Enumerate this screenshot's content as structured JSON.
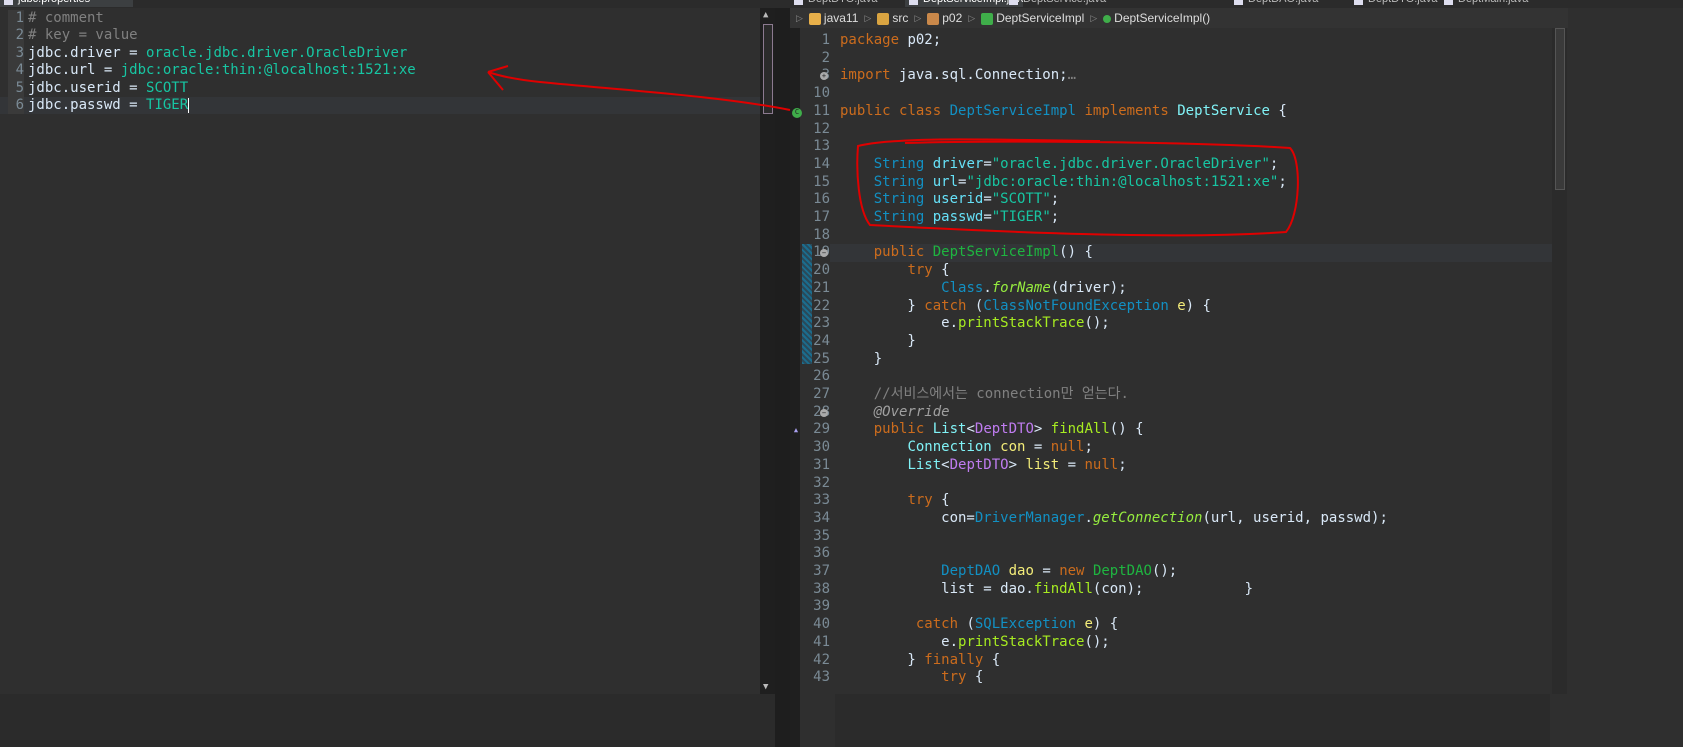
{
  "tabs": [
    {
      "label": "jdbc.properties",
      "active": true
    },
    {
      "label": "DeptDTO.java",
      "active": false
    },
    {
      "label": "DeptServiceImpl.java",
      "active": true
    },
    {
      "label": "DeptService.java",
      "active": false
    },
    {
      "label": "DeptDAO.java",
      "active": false
    },
    {
      "label": "DeptDTO.java",
      "active": false
    },
    {
      "label": "DeptMain.java",
      "active": false
    }
  ],
  "properties_editor": {
    "lines": [
      {
        "num": "1",
        "key": "# comment",
        "value": "",
        "comment": true
      },
      {
        "num": "2",
        "key": "# key = value",
        "value": "",
        "comment": true
      },
      {
        "num": "3",
        "key": "jdbc.driver = ",
        "value": "oracle.jdbc.driver.OracleDriver"
      },
      {
        "num": "4",
        "key": "jdbc.url = ",
        "value": "jdbc:oracle:thin:@localhost:1521:xe"
      },
      {
        "num": "5",
        "key": "jdbc.userid = ",
        "value": "SCOTT"
      },
      {
        "num": "6",
        "key": "jdbc.passwd = ",
        "value": "TIGER"
      }
    ]
  },
  "breadcrumb": [
    {
      "label": "java11",
      "icon": "project-icon",
      "color": "#e8b04a"
    },
    {
      "label": "src",
      "icon": "source-folder-icon",
      "color": "#d9a441"
    },
    {
      "label": "p02",
      "icon": "package-icon",
      "color": "#c9884a"
    },
    {
      "label": "DeptServiceImpl",
      "icon": "class-icon",
      "color": "#3fae4a"
    },
    {
      "label": "DeptServiceImpl()",
      "icon": "constructor-icon",
      "color": "#3fae4a"
    }
  ],
  "java_editor": {
    "lines": [
      {
        "num": "1",
        "tokens": [
          [
            "package",
            "k"
          ],
          [
            " p02;",
            "p"
          ]
        ]
      },
      {
        "num": "2",
        "tokens": []
      },
      {
        "num": "3",
        "marker": "fold-expand",
        "tokens": [
          [
            "import",
            "k"
          ],
          [
            " java.sql.Connection;",
            "p"
          ],
          [
            "…",
            "c"
          ]
        ]
      },
      {
        "num": "10",
        "tokens": []
      },
      {
        "num": "11",
        "marker": "class",
        "tokens": [
          [
            "public",
            "k"
          ],
          [
            " ",
            "p"
          ],
          [
            "class",
            "k"
          ],
          [
            " ",
            "p"
          ],
          [
            "DeptServiceImpl",
            "t"
          ],
          [
            " ",
            "p"
          ],
          [
            "implements",
            "k"
          ],
          [
            " ",
            "p"
          ],
          [
            "DeptService",
            "i"
          ],
          [
            " {",
            "p"
          ]
        ]
      },
      {
        "num": "12",
        "tokens": []
      },
      {
        "num": "13",
        "tokens": []
      },
      {
        "num": "14",
        "tokens": [
          [
            "    ",
            "p"
          ],
          [
            "String",
            "t"
          ],
          [
            " ",
            "p"
          ],
          [
            "driver",
            "f"
          ],
          [
            "=",
            "p"
          ],
          [
            "\"oracle.jdbc.driver.OracleDriver\"",
            "s"
          ],
          [
            ";",
            "p"
          ]
        ]
      },
      {
        "num": "15",
        "tokens": [
          [
            "    ",
            "p"
          ],
          [
            "String",
            "t"
          ],
          [
            " ",
            "p"
          ],
          [
            "url",
            "f"
          ],
          [
            "=",
            "p"
          ],
          [
            "\"jdbc:oracle:thin:@localhost:1521:xe\"",
            "s"
          ],
          [
            ";",
            "p"
          ]
        ]
      },
      {
        "num": "16",
        "tokens": [
          [
            "    ",
            "p"
          ],
          [
            "String",
            "t"
          ],
          [
            " ",
            "p"
          ],
          [
            "userid",
            "f"
          ],
          [
            "=",
            "p"
          ],
          [
            "\"SCOTT\"",
            "s"
          ],
          [
            ";",
            "p"
          ]
        ]
      },
      {
        "num": "17",
        "tokens": [
          [
            "    ",
            "p"
          ],
          [
            "String",
            "t"
          ],
          [
            " ",
            "p"
          ],
          [
            "passwd",
            "f"
          ],
          [
            "=",
            "p"
          ],
          [
            "\"TIGER\"",
            "s"
          ],
          [
            ";",
            "p"
          ]
        ]
      },
      {
        "num": "18",
        "tokens": []
      },
      {
        "num": "19",
        "marker": "fold-collapse",
        "current": true,
        "tokens": [
          [
            "    ",
            "p"
          ],
          [
            "public",
            "k"
          ],
          [
            " ",
            "p"
          ],
          [
            "DeptServiceImpl",
            "cn"
          ],
          [
            "() {",
            "p"
          ]
        ]
      },
      {
        "num": "20",
        "tokens": [
          [
            "        ",
            "p"
          ],
          [
            "try",
            "k"
          ],
          [
            " {",
            "p"
          ]
        ]
      },
      {
        "num": "21",
        "tokens": [
          [
            "            ",
            "p"
          ],
          [
            "Class",
            "t"
          ],
          [
            ".",
            "p"
          ],
          [
            "forName",
            "mi"
          ],
          [
            "(driver);",
            "p"
          ]
        ]
      },
      {
        "num": "22",
        "tokens": [
          [
            "        } ",
            "p"
          ],
          [
            "catch",
            "k"
          ],
          [
            " (",
            "p"
          ],
          [
            "ClassNotFoundException",
            "t"
          ],
          [
            " ",
            "p"
          ],
          [
            "e",
            "v"
          ],
          [
            ") {",
            "p"
          ]
        ]
      },
      {
        "num": "23",
        "tokens": [
          [
            "            e.",
            "p"
          ],
          [
            "printStackTrace",
            "m"
          ],
          [
            "();",
            "p"
          ]
        ]
      },
      {
        "num": "24",
        "tokens": [
          [
            "        }",
            "p"
          ]
        ]
      },
      {
        "num": "25",
        "tokens": [
          [
            "    }",
            "p"
          ]
        ]
      },
      {
        "num": "26",
        "tokens": []
      },
      {
        "num": "27",
        "tokens": [
          [
            "    ",
            "p"
          ],
          [
            "//서비스에서는 connection만 얻는다.",
            "c"
          ]
        ]
      },
      {
        "num": "28",
        "marker": "fold-collapse",
        "tokens": [
          [
            "    ",
            "p"
          ],
          [
            "@Override",
            "a"
          ]
        ]
      },
      {
        "num": "29",
        "marker": "override",
        "tokens": [
          [
            "    ",
            "p"
          ],
          [
            "public",
            "k"
          ],
          [
            " ",
            "p"
          ],
          [
            "List",
            "i"
          ],
          [
            "<",
            "p"
          ],
          [
            "DeptDTO",
            "g"
          ],
          [
            "> ",
            "p"
          ],
          [
            "findAll",
            "m"
          ],
          [
            "() {",
            "p"
          ]
        ]
      },
      {
        "num": "30",
        "tokens": [
          [
            "        ",
            "p"
          ],
          [
            "Connection",
            "i"
          ],
          [
            " ",
            "p"
          ],
          [
            "con",
            "v"
          ],
          [
            " = ",
            "p"
          ],
          [
            "null",
            "k"
          ],
          [
            ";",
            "p"
          ]
        ]
      },
      {
        "num": "31",
        "tokens": [
          [
            "        ",
            "p"
          ],
          [
            "List",
            "i"
          ],
          [
            "<",
            "p"
          ],
          [
            "DeptDTO",
            "g"
          ],
          [
            "> ",
            "p"
          ],
          [
            "list",
            "v"
          ],
          [
            " = ",
            "p"
          ],
          [
            "null",
            "k"
          ],
          [
            ";",
            "p"
          ]
        ]
      },
      {
        "num": "32",
        "tokens": []
      },
      {
        "num": "33",
        "tokens": [
          [
            "        ",
            "p"
          ],
          [
            "try",
            "k"
          ],
          [
            " {",
            "p"
          ]
        ]
      },
      {
        "num": "34",
        "tokens": [
          [
            "            con=",
            "p"
          ],
          [
            "DriverManager",
            "t"
          ],
          [
            ".",
            "p"
          ],
          [
            "getConnection",
            "mi"
          ],
          [
            "(url, userid, passwd);",
            "p"
          ]
        ]
      },
      {
        "num": "35",
        "tokens": []
      },
      {
        "num": "36",
        "tokens": []
      },
      {
        "num": "37",
        "tokens": [
          [
            "            ",
            "p"
          ],
          [
            "DeptDAO",
            "t"
          ],
          [
            " ",
            "p"
          ],
          [
            "dao",
            "v"
          ],
          [
            " = ",
            "p"
          ],
          [
            "new",
            "k"
          ],
          [
            " ",
            "p"
          ],
          [
            "DeptDAO",
            "cn"
          ],
          [
            "();",
            "p"
          ]
        ]
      },
      {
        "num": "38",
        "tokens": [
          [
            "            list = dao.",
            "p"
          ],
          [
            "findAll",
            "m"
          ],
          [
            "(con);            }",
            "p"
          ]
        ]
      },
      {
        "num": "39",
        "tokens": []
      },
      {
        "num": "40",
        "tokens": [
          [
            "         ",
            "p"
          ],
          [
            "catch",
            "k"
          ],
          [
            " (",
            "p"
          ],
          [
            "SQLException",
            "t"
          ],
          [
            " ",
            "p"
          ],
          [
            "e",
            "v"
          ],
          [
            ") {",
            "p"
          ]
        ]
      },
      {
        "num": "41",
        "tokens": [
          [
            "            e.",
            "p"
          ],
          [
            "printStackTrace",
            "m"
          ],
          [
            "();",
            "p"
          ]
        ]
      },
      {
        "num": "42",
        "tokens": [
          [
            "        } ",
            "p"
          ],
          [
            "finally",
            "k"
          ],
          [
            " {",
            "p"
          ]
        ]
      },
      {
        "num": "43",
        "tokens": [
          [
            "            ",
            "p"
          ],
          [
            "try",
            "k"
          ],
          [
            " {",
            "p"
          ]
        ]
      }
    ]
  },
  "colors": {
    "annotation": "#e00000",
    "background": "#2f2f2f"
  }
}
